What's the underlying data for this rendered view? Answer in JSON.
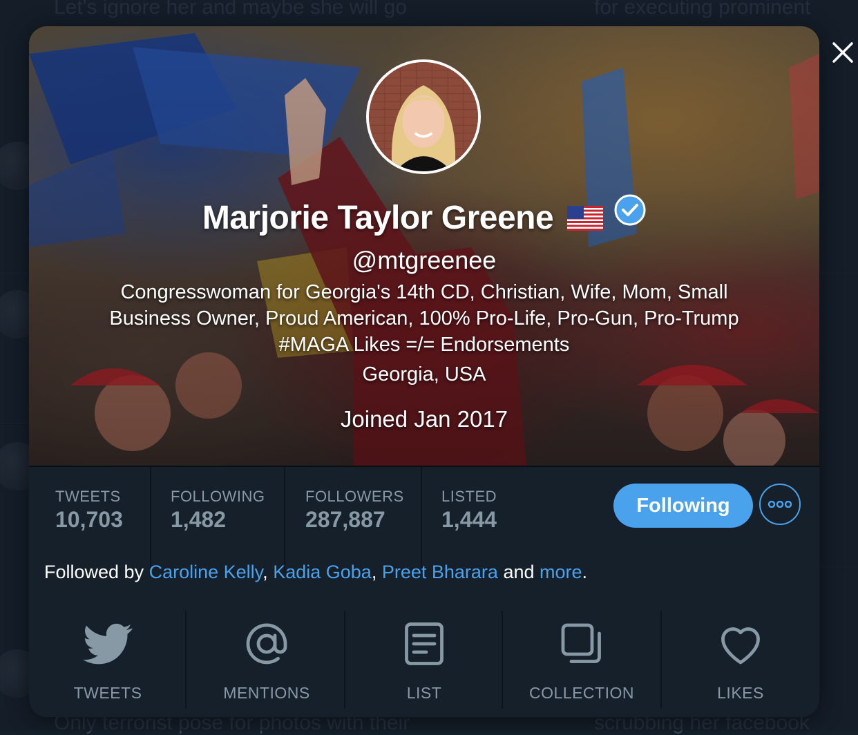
{
  "background": {
    "snippets": [
      "Let's ignore her and maybe she will go",
      "for executing prominent",
      "Only terrorist pose for photos with their",
      "scrubbing her facebook"
    ]
  },
  "profile": {
    "name": "Marjorie Taylor Greene",
    "handle": "@mtgreenee",
    "bio": "Congresswoman for Georgia's 14th CD, Christian, Wife, Mom, Small Business Owner, Proud American, 100% Pro-Life, Pro-Gun, Pro-Trump #MAGA Likes =/= Endorsements",
    "location": "Georgia, USA",
    "joined": "Joined Jan 2017",
    "verified": true
  },
  "stats": [
    {
      "label": "TWEETS",
      "value": "10,703"
    },
    {
      "label": "FOLLOWING",
      "value": "1,482"
    },
    {
      "label": "FOLLOWERS",
      "value": "287,887"
    },
    {
      "label": "LISTED",
      "value": "1,444"
    }
  ],
  "actions": {
    "following_label": "Following"
  },
  "followed_by": {
    "prefix": "Followed by",
    "names": [
      "Caroline Kelly",
      "Kadia Goba",
      "Preet Bharara"
    ],
    "comma": ",",
    "and": "and",
    "more": "more",
    "period": "."
  },
  "nav": [
    {
      "label": "TWEETS",
      "icon": "twitter-bird-icon"
    },
    {
      "label": "MENTIONS",
      "icon": "at-sign-icon"
    },
    {
      "label": "LIST",
      "icon": "list-icon"
    },
    {
      "label": "COLLECTION",
      "icon": "collection-icon"
    },
    {
      "label": "LIKES",
      "icon": "heart-icon"
    }
  ],
  "colors": {
    "accent": "#4aa1ec",
    "card_bg": "#15202b",
    "muted": "#8899a6"
  }
}
